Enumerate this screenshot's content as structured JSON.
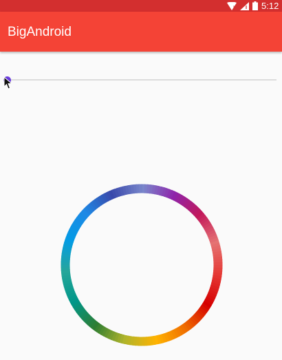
{
  "status_bar": {
    "time": "5:12",
    "icons": [
      "wifi-icon",
      "signal-icon",
      "battery-icon"
    ],
    "background": "#d32f2f"
  },
  "app_bar": {
    "title": "BigAndroid",
    "background": "#f44336"
  },
  "seekbar": {
    "progress": 0,
    "thumb_color": "#6a3ddc",
    "track_color": "#dcdcdc"
  },
  "color_ring": {
    "colors": [
      "#7986cb",
      "#8e24aa",
      "#c2185b",
      "#e57373",
      "#e53935",
      "#d50000",
      "#ef6c00",
      "#ffb300",
      "#afb42b",
      "#2e7d32",
      "#009688",
      "#26a69a",
      "#039be5",
      "#1e88e5",
      "#3949ab"
    ]
  }
}
